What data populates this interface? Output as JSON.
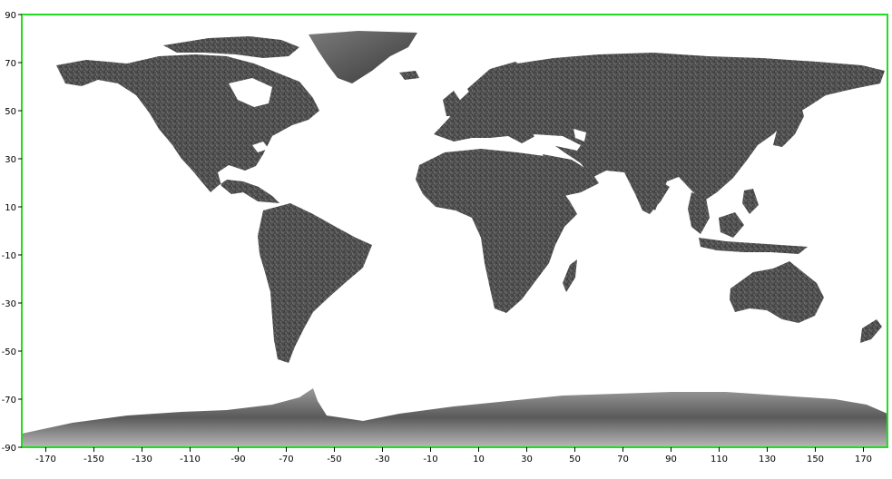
{
  "map": {
    "projection": "equirectangular",
    "frame_color": "#22dd22",
    "land_color": "#4a4a4a",
    "ice_color": "#8a8a8a",
    "ocean_color": "#ffffff",
    "lon_range": [
      -180,
      180
    ],
    "lat_range": [
      -90,
      90
    ],
    "x_ticks": [
      {
        "value": -170,
        "label": "-170"
      },
      {
        "value": -150,
        "label": "-150"
      },
      {
        "value": -130,
        "label": "-130"
      },
      {
        "value": -110,
        "label": "-110"
      },
      {
        "value": -90,
        "label": "-90"
      },
      {
        "value": -70,
        "label": "-70"
      },
      {
        "value": -50,
        "label": "-50"
      },
      {
        "value": -30,
        "label": "-30"
      },
      {
        "value": -10,
        "label": "-10"
      },
      {
        "value": 10,
        "label": "10"
      },
      {
        "value": 30,
        "label": "30"
      },
      {
        "value": 50,
        "label": "50"
      },
      {
        "value": 70,
        "label": "70"
      },
      {
        "value": 90,
        "label": "90"
      },
      {
        "value": 110,
        "label": "110"
      },
      {
        "value": 130,
        "label": "130"
      },
      {
        "value": 150,
        "label": "150"
      },
      {
        "value": 170,
        "label": "170"
      }
    ],
    "y_ticks": [
      {
        "value": 90,
        "label": "90"
      },
      {
        "value": 70,
        "label": "70"
      },
      {
        "value": 50,
        "label": "50"
      },
      {
        "value": 30,
        "label": "30"
      },
      {
        "value": 10,
        "label": "10"
      },
      {
        "value": -10,
        "label": "-10"
      },
      {
        "value": -30,
        "label": "-30"
      },
      {
        "value": -50,
        "label": "-50"
      },
      {
        "value": -70,
        "label": "-70"
      },
      {
        "value": -90,
        "label": "-90"
      }
    ]
  }
}
